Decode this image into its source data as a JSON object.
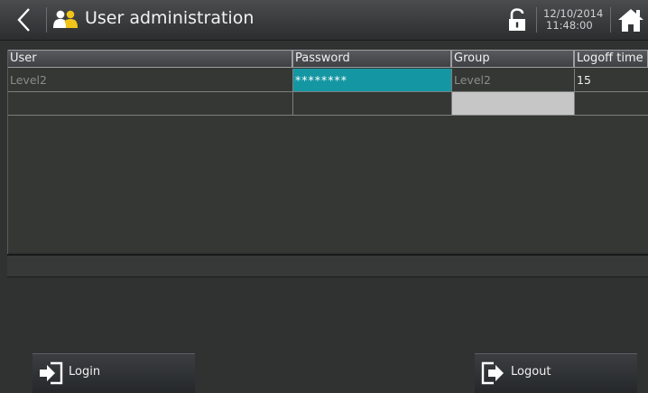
{
  "header": {
    "title": "User administration",
    "date": "12/10/2014",
    "time": "11:48:00"
  },
  "table": {
    "columns": [
      "User",
      "Password",
      "Group",
      "Logoff time"
    ],
    "rows": [
      {
        "user": "Level2",
        "password": "********",
        "group": "Level2",
        "logoff_time": "15"
      },
      {
        "user": "",
        "password": "",
        "group": "",
        "logoff_time": ""
      }
    ]
  },
  "buttons": {
    "login": "Login",
    "logout": "Logout"
  },
  "icons": {
    "back": "chevron-left-icon",
    "users": "users-icon",
    "lock": "unlocked-padlock-icon",
    "home": "home-icon",
    "login": "login-arrow-icon",
    "logout": "logout-arrow-icon"
  },
  "colors": {
    "selected_cell": "#1597a3",
    "grey_cell": "#c6c6c6",
    "accent_yellow": "#f0c419",
    "dim_text": "#8a8c8a"
  }
}
